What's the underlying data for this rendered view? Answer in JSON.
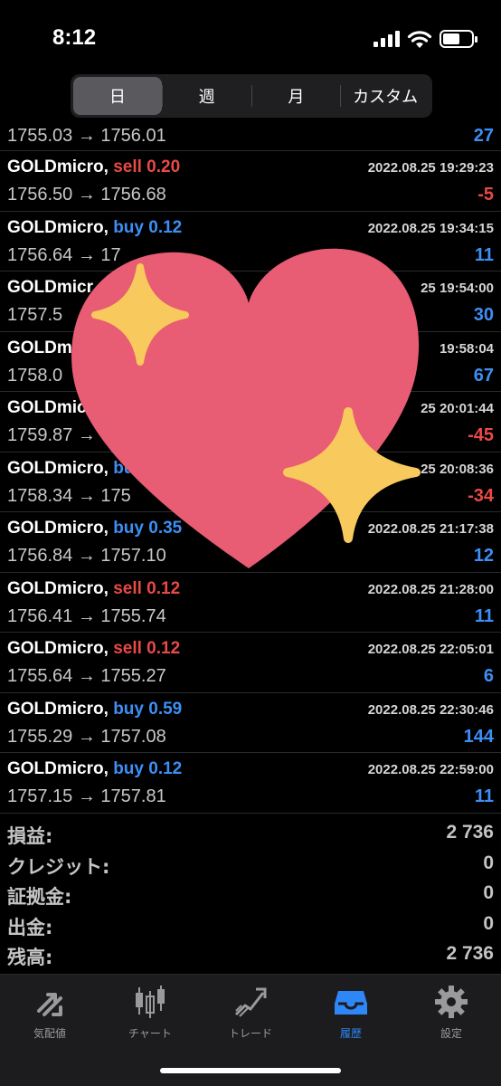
{
  "status": {
    "time": "8:12"
  },
  "segments": [
    {
      "label": "日",
      "active": true
    },
    {
      "label": "週",
      "active": false
    },
    {
      "label": "月",
      "active": false
    },
    {
      "label": "カスタム",
      "active": false
    }
  ],
  "partial_row": {
    "prices": "1755.03 → 1756.01",
    "profit": "27"
  },
  "deals": [
    {
      "symbol": "GOLDmicro,",
      "side": "sell",
      "volume": "0.20",
      "date": "2022.08.25 19:29:23",
      "prices": "1756.50 → 1756.68",
      "profit": "-5"
    },
    {
      "symbol": "GOLDmicro,",
      "side": "buy",
      "volume": "0.12",
      "date": "2022.08.25 19:34:15",
      "prices": "1756.64 → 17",
      "profit": "11"
    },
    {
      "symbol": "GOLDmicr",
      "side": "",
      "volume": "",
      "date": "25 19:54:00",
      "prices": "1757.5",
      "profit": "30"
    },
    {
      "symbol": "GOLDmi",
      "side": "",
      "volume": "",
      "date": "19:58:04",
      "prices": "1758.0",
      "profit": "67"
    },
    {
      "symbol": "GOLDmic",
      "side": "",
      "volume": "",
      "date": "25 20:01:44",
      "prices": "1759.87 →",
      "profit": "-45"
    },
    {
      "symbol": "GOLDmicro,",
      "side": "bu",
      "volume": "",
      "date": "25 20:08:36",
      "prices": "1758.34 → 175",
      "profit": "-34"
    },
    {
      "symbol": "GOLDmicro,",
      "side": "buy",
      "volume": "0.35",
      "date": "2022.08.25 21:17:38",
      "prices": "1756.84 → 1757.10",
      "profit": "12"
    },
    {
      "symbol": "GOLDmicro,",
      "side": "sell",
      "volume": "0.12",
      "date": "2022.08.25 21:28:00",
      "prices": "1756.41 → 1755.74",
      "profit": "11"
    },
    {
      "symbol": "GOLDmicro,",
      "side": "sell",
      "volume": "0.12",
      "date": "2022.08.25 22:05:01",
      "prices": "1755.64 → 1755.27",
      "profit": "6"
    },
    {
      "symbol": "GOLDmicro,",
      "side": "buy",
      "volume": "0.59",
      "date": "2022.08.25 22:30:46",
      "prices": "1755.29 → 1757.08",
      "profit": "144"
    },
    {
      "symbol": "GOLDmicro,",
      "side": "buy",
      "volume": "0.12",
      "date": "2022.08.25 22:59:00",
      "prices": "1757.15 → 1757.81",
      "profit": "11"
    }
  ],
  "summary": [
    {
      "label": "損益:",
      "value": "2 736"
    },
    {
      "label": "クレジット:",
      "value": "0"
    },
    {
      "label": "証拠金:",
      "value": "0"
    },
    {
      "label": "出金:",
      "value": "0"
    },
    {
      "label": "残高:",
      "value": "2 736"
    }
  ],
  "tabs": [
    {
      "label": "気配値",
      "icon": "quotes-arrows-icon",
      "active": false
    },
    {
      "label": "チャート",
      "icon": "candlestick-chart-icon",
      "active": false
    },
    {
      "label": "トレード",
      "icon": "trade-trend-icon",
      "active": false
    },
    {
      "label": "履歴",
      "icon": "history-inbox-icon",
      "active": true
    },
    {
      "label": "設定",
      "icon": "gear-icon",
      "active": false
    }
  ],
  "colors": {
    "buy": "#3d8ff5",
    "sell": "#e84a47",
    "active_tab": "#2f86f6",
    "heart": "#e85c74",
    "sparkle": "#f8c95c"
  }
}
